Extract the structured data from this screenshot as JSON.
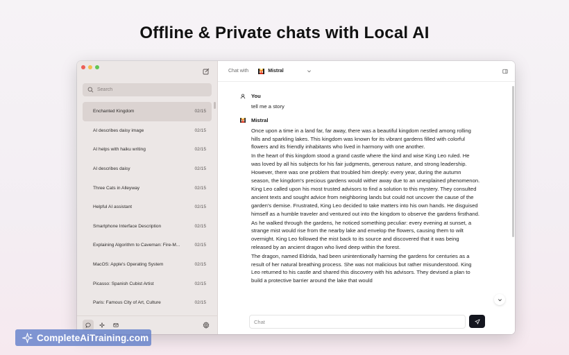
{
  "headline": "Offline & Private chats with Local AI",
  "sidebar": {
    "search_placeholder": "Search",
    "threads": [
      {
        "title": "Enchanted Kingdom",
        "date": "02/15"
      },
      {
        "title": "AI describes daisy image",
        "date": "02/15"
      },
      {
        "title": "AI helps with haiku writing",
        "date": "02/15"
      },
      {
        "title": "AI describes daisy",
        "date": "02/15"
      },
      {
        "title": "Three Cats in Alleyway",
        "date": "02/15"
      },
      {
        "title": "Helpful AI assistant",
        "date": "02/15"
      },
      {
        "title": "Smartphone Interface Description",
        "date": "02/15"
      },
      {
        "title": "Explaining Algorithm to Caveman: Fire-M...",
        "date": "02/15"
      },
      {
        "title": "MacOS: Apple's Operating System",
        "date": "02/15"
      },
      {
        "title": "Picasso: Spanish Cubist Artist",
        "date": "02/15"
      },
      {
        "title": "Paris: Famous City of Art, Culture",
        "date": "02/15"
      }
    ]
  },
  "topbar": {
    "chat_with_label": "Chat with",
    "model_name": "Mistral"
  },
  "messages": {
    "user_name": "You",
    "user_text": "tell me a story",
    "assistant_name": "Mistral",
    "paragraphs": [
      "Once upon a time in a land far, far away, there was a beautiful kingdom nestled among rolling hills and sparkling lakes. This kingdom was known for its vibrant gardens filled with colorful flowers and its friendly inhabitants who lived in harmony with one another.",
      "In the heart of this kingdom stood a grand castle where the kind and wise King Leo ruled. He was loved by all his subjects for his fair judgments, generous nature, and strong leadership. However, there was one problem that troubled him deeply: every year, during the autumn season, the kingdom's precious gardens would wither away due to an unexplained phenomenon.",
      "King Leo called upon his most trusted advisors to find a solution to this mystery. They consulted ancient texts and sought advice from neighboring lands but could not uncover the cause of the garden's demise. Frustrated, King Leo decided to take matters into his own hands. He disguised himself as a humble traveler and ventured out into the kingdom to observe the gardens firsthand.",
      "As he walked through the gardens, he noticed something peculiar: every evening at sunset, a strange mist would rise from the nearby lake and envelop the flowers, causing them to wilt overnight. King Leo followed the mist back to its source and discovered that it was being released by an ancient dragon who lived deep within the forest.",
      "The dragon, named Eldrida, had been unintentionally harming the gardens for centuries as a result of her natural breathing process. She was not malicious but rather misunderstood. King Leo returned to his castle and shared this discovery with his advisors. They devised a plan to build a protective barrier around the lake that would"
    ]
  },
  "composer": {
    "placeholder": "Chat"
  },
  "watermark": {
    "text": "CompleteAiTraining.com"
  },
  "icons": {
    "compose": "compose-icon",
    "search": "search-icon",
    "chat": "chat-bubble-icon",
    "sparkle": "sparkle-icon",
    "mail": "mail-icon",
    "settings": "gear-icon",
    "panel": "sidebar-panel-icon",
    "send": "send-icon",
    "scroll_down": "chevron-down-icon"
  },
  "colors": {
    "accent_dark": "#14161f",
    "sidebar_bg": "#ece7e6",
    "active_thread": "#dbd3d1",
    "mistral_orange": "#e8592a"
  }
}
